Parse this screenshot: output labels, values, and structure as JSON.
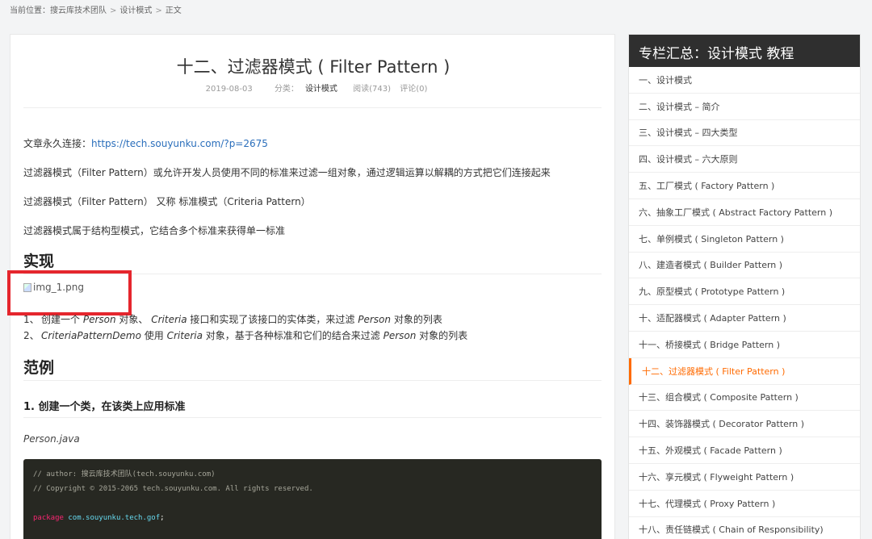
{
  "breadcrumb": {
    "prefix": "当前位置：",
    "items": [
      "搜云库技术团队",
      "设计模式",
      "正文"
    ],
    "separator": ">"
  },
  "article": {
    "title": "十二、过滤器模式 ( Filter Pattern )",
    "date": "2019-08-03",
    "category_label": "分类：",
    "category": "设计模式",
    "reads": "阅读(743)",
    "comments": "评论(0)",
    "permalink_label": "文章永久连接：",
    "permalink": "https://tech.souyunku.com/?p=2675",
    "para1": "过滤器模式（Filter Pattern）或允许开发人员使用不同的标准来过滤一组对象，通过逻辑运算以解耦的方式把它们连接起来",
    "para2": "过滤器模式（Filter Pattern） 又称 标准模式（Criteria Pattern）",
    "para3": "过滤器模式属于结构型模式，它结合多个标准来获得单一标准",
    "section1": "实现",
    "image_alt": "img_1.png",
    "list": [
      {
        "num": "1、",
        "parts": [
          "创建一个 ",
          "Person",
          " 对象、 ",
          "Criteria",
          " 接口和实现了该接口的实体类，来过滤 ",
          "Person",
          " 对象的列表"
        ]
      },
      {
        "num": "2、",
        "parts": [
          "",
          "CriteriaPatternDemo",
          " 使用 ",
          "Criteria",
          " 对象，基于各种标准和它们的结合来过滤 ",
          "Person",
          " 对象的列表"
        ]
      }
    ],
    "section2": "范例",
    "step1": "1. 创建一个类，在该类上应用标准",
    "filename": "Person.java",
    "code": {
      "comment1": "// author: 搜云库技术团队(tech.souyunku.com)",
      "comment2": "// Copyright © 2015-2065 tech.souyunku.com. All rights reserved.",
      "keyword": "package",
      "package_name": "com.souyunku.tech.gof",
      "semicolon": ";"
    }
  },
  "sidebar": {
    "title": "专栏汇总：设计模式 教程",
    "active_index": 11,
    "items": [
      "一、设计模式",
      "二、设计模式 – 简介",
      "三、设计模式 – 四大类型",
      "四、设计模式 – 六大原则",
      "五、工厂模式 ( Factory Pattern )",
      "六、抽象工厂模式 ( Abstract Factory Pattern )",
      "七、单例模式 ( Singleton Pattern )",
      "八、建造者模式 ( Builder Pattern )",
      "九、原型模式 ( Prototype Pattern )",
      "十、适配器模式 ( Adapter Pattern )",
      "十一、桥接模式 ( Bridge Pattern )",
      "十二、过滤器模式 ( Filter Pattern )",
      "十三、组合模式 ( Composite Pattern )",
      "十四、装饰器模式 ( Decorator Pattern )",
      "十五、外观模式 ( Facade Pattern )",
      "十六、享元模式 ( Flyweight Pattern )",
      "十七、代理模式 ( Proxy Pattern )",
      "十八、责任链模式 ( Chain of Responsibility)"
    ]
  }
}
